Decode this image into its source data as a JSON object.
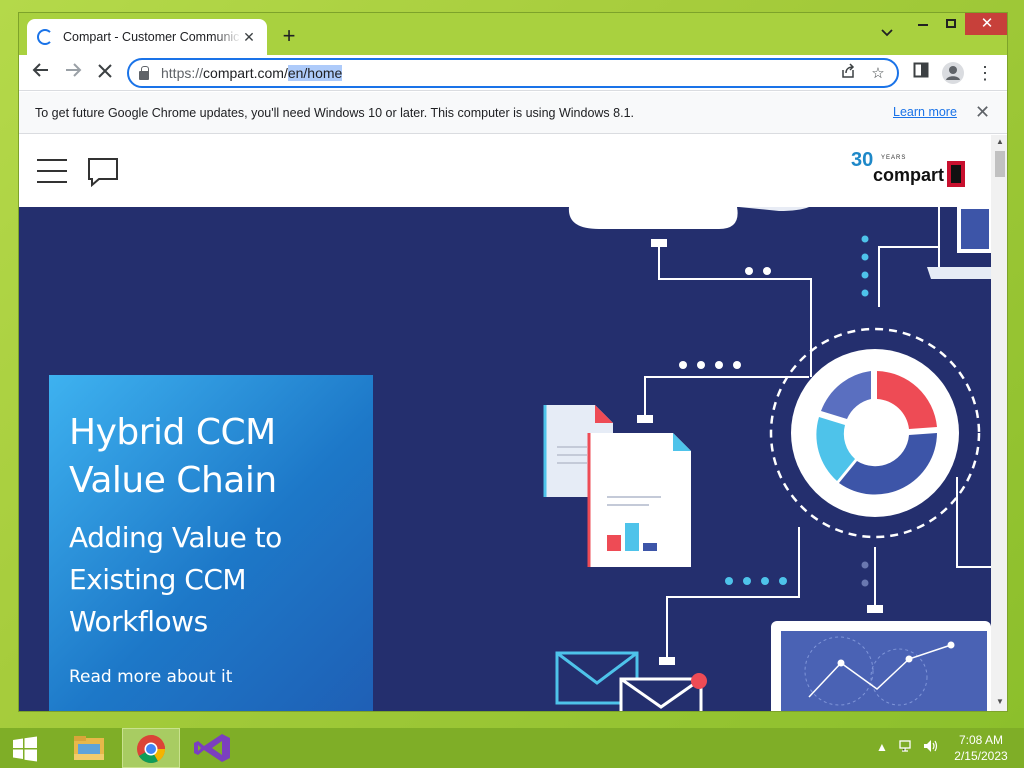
{
  "browser": {
    "tab_title": "Compart - Customer Communica",
    "new_tab": "+",
    "url_prefix": "https://",
    "url_host": "compart.com",
    "url_slash": "/",
    "url_path_selected": "en/home",
    "infobar_text": "To get future Google Chrome updates, you'll need Windows 10 or later. This computer is using Windows 8.1.",
    "infobar_link": "Learn more"
  },
  "site": {
    "logo_number": "30",
    "logo_years": "YEARS",
    "logo_brand": "compart",
    "hero_title": "Hybrid CCM Value Chain",
    "hero_subtitle": "Adding Value to Existing CCM Workflows",
    "hero_link": "Read more about it"
  },
  "taskbar": {
    "time": "7:08 AM",
    "date": "2/15/2023"
  },
  "colors": {
    "hero_bg": "#242f6e",
    "card_accent": "#1d78c8",
    "desktop_green": "#a6cc3c",
    "close_red": "#c7403a"
  }
}
